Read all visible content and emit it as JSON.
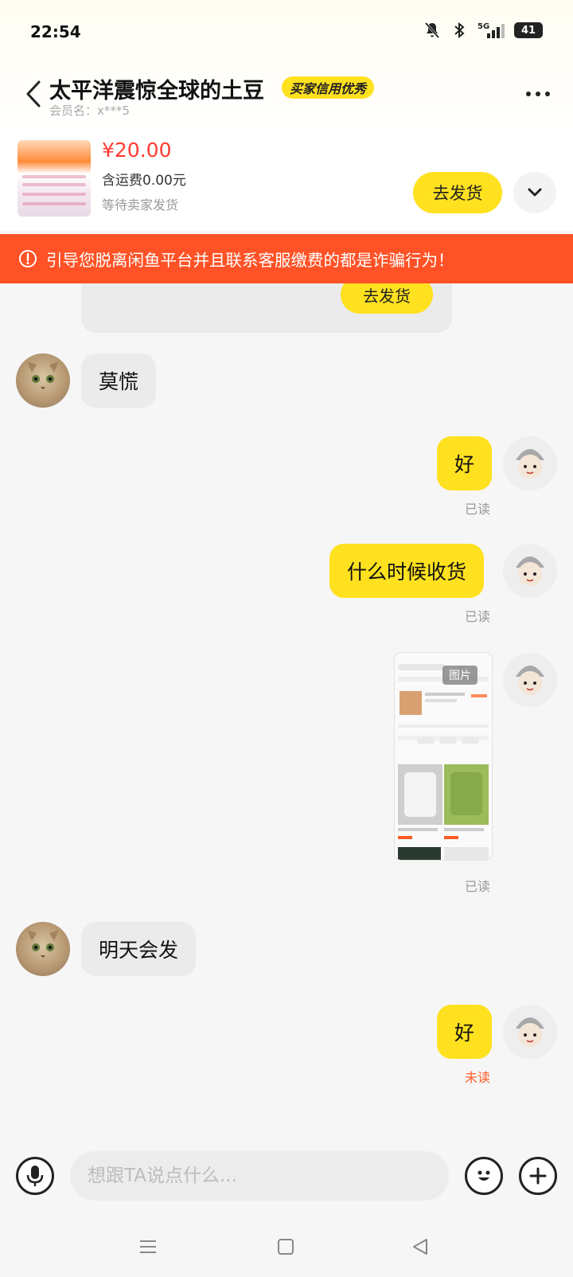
{
  "status_bar": {
    "time": "22:54",
    "network": "5G",
    "battery": "41"
  },
  "header": {
    "title": "太平洋震惊全球的土豆",
    "badge": "买家信用优秀",
    "member": "会员名：x***5"
  },
  "product": {
    "price": "¥20.00",
    "shipping": "含运费0.00元",
    "status": "等待卖家发货",
    "ship_button": "去发货"
  },
  "warning": {
    "text": "引导您脱离闲鱼平台并且联系客服缴费的都是诈骗行为！"
  },
  "messages": [
    {
      "side": "left",
      "text": "莫慌"
    },
    {
      "side": "right",
      "text": "好",
      "status": "已读"
    },
    {
      "side": "right",
      "text": "什么时候收货",
      "status": "已读"
    },
    {
      "side": "right",
      "type": "image",
      "tag": "图片",
      "status": "已读"
    },
    {
      "side": "left",
      "text": "明天会发"
    },
    {
      "side": "right",
      "text": "好",
      "status": "未读"
    }
  ],
  "card_remnant": {
    "ship_button": "去发货"
  },
  "input": {
    "placeholder": "想跟TA说点什么..."
  },
  "colors": {
    "accent_yellow": "#ffe11f",
    "warning_orange": "#ff5226",
    "price_red": "#ff3b30",
    "unread_orange": "#ff5a26"
  },
  "icons": [
    "back-icon",
    "more-icon",
    "chevron-down-icon",
    "warning-icon",
    "microphone-icon",
    "emoji-icon",
    "plus-icon",
    "menu-icon",
    "home-icon",
    "back-nav-icon",
    "mute-icon",
    "bluetooth-icon",
    "signal-icon"
  ]
}
